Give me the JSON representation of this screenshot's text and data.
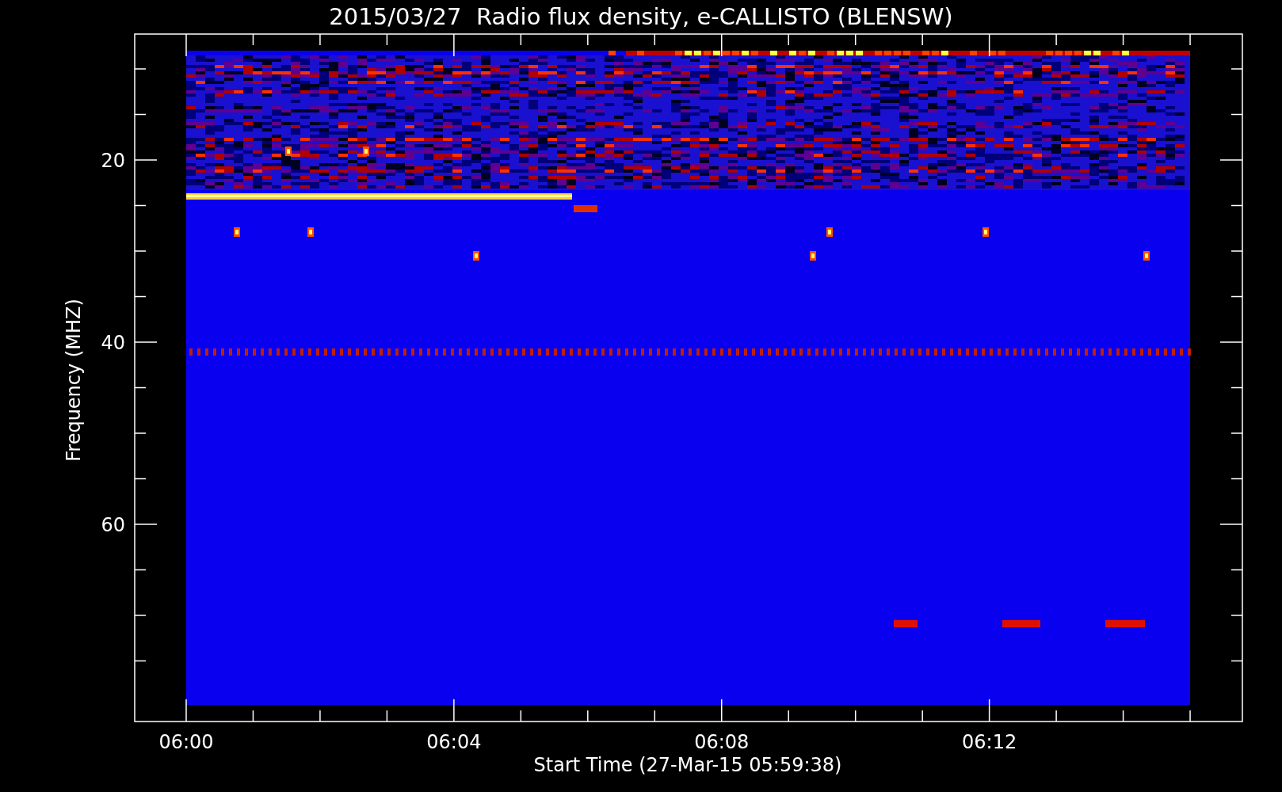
{
  "title": "2015/03/27  Radio flux density, e-CALLISTO (BLENSW)",
  "y_axis": {
    "label": "Frequency (MHZ)",
    "ticks": [
      "20",
      "40",
      "60"
    ]
  },
  "x_axis": {
    "label": "Start Time (27-Mar-15 05:59:38)",
    "ticks": [
      "06:00",
      "06:04",
      "06:08",
      "06:12"
    ]
  }
}
